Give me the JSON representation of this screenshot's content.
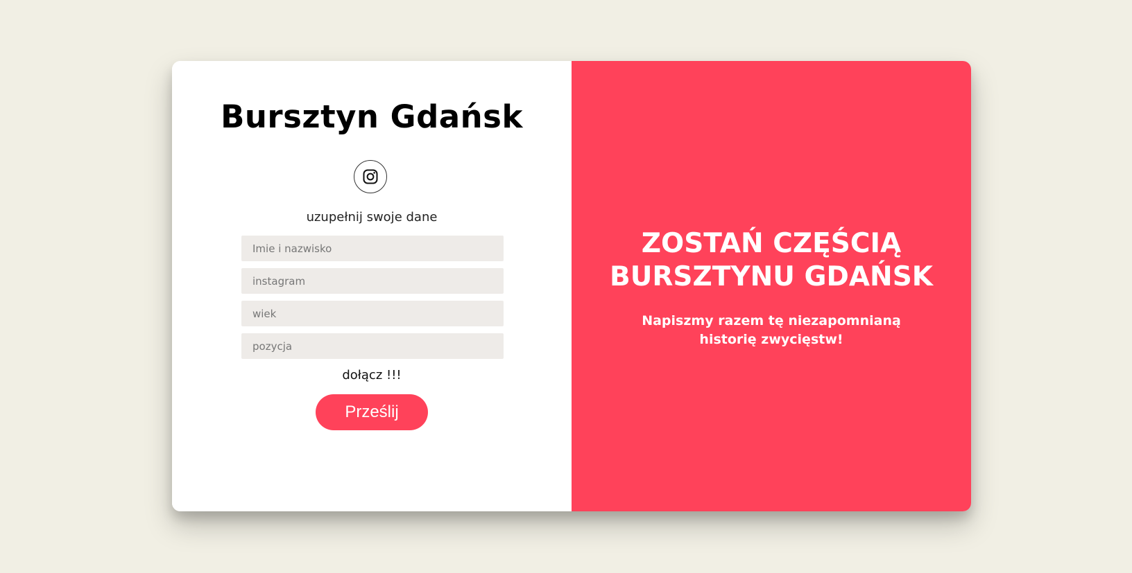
{
  "brand": {
    "title": "Bursztyn Gdańsk"
  },
  "social": {
    "icon": "instagram-icon"
  },
  "form": {
    "caption": "uzupełnij swoje dane",
    "fields": {
      "name_placeholder": "Imie i nazwisko",
      "instagram_placeholder": "instagram",
      "age_placeholder": "wiek",
      "position_placeholder": "pozycja"
    },
    "join_text": "dołącz !!!",
    "submit_label": "Prześlij"
  },
  "promo": {
    "heading": "ZOSTAŃ CZĘŚCIĄ BURSZTYNU GDAŃSK",
    "text": "Napiszmy razem tę niezapomnianą historię zwycięstw!"
  },
  "colors": {
    "background": "#f1efe4",
    "accent": "#ff425a",
    "input_background": "#eeebe8"
  }
}
